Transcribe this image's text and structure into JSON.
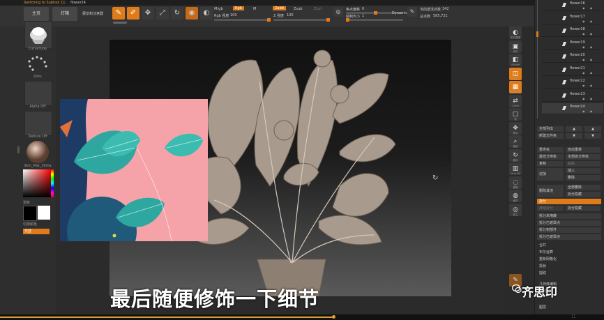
{
  "window": {
    "title": "Switching to Subtool 11:",
    "active_subtool": "flower24"
  },
  "toolbar": {
    "home": "主页",
    "lightbox": "灯箱",
    "lightbox_sub": "展览和注意器",
    "tools": [
      {
        "label": "Edit",
        "icon": "edit-icon",
        "active": true
      },
      {
        "label": "Draw",
        "icon": "draw-icon",
        "active": true
      },
      {
        "label": "Move",
        "icon": "move-icon",
        "active": false
      },
      {
        "label": "Scale",
        "icon": "scale-icon",
        "active": false
      },
      {
        "label": "Rotate",
        "icon": "rotate-icon",
        "active": false
      }
    ],
    "mrgb": "Mrgb",
    "rgb": "Rgb",
    "m": "M",
    "rgb_intensity_label": "Rgb 强度",
    "rgb_intensity_value": "100",
    "zadd": "Zadd",
    "zsub": "Zsub",
    "zcut": "Zcut",
    "z_intensity_label": "Z 强度",
    "z_intensity_value": "100",
    "focal_shift_label": "焦点偏移",
    "focal_shift_value": "0",
    "draw_size_label": "绘制大小",
    "draw_size_value": "1",
    "dynamic": "Dynamic",
    "active_points_label": "当前激活点数",
    "active_points_value": "342",
    "total_points_label": "总点数",
    "total_points_value": "585,721"
  },
  "left_panel": {
    "brush_name": "CurveTube",
    "stroke_name": "Dots",
    "alpha_name": "Alpha Off",
    "texture_name": "Texture Off",
    "material_name": "Skin_Mat_30ma",
    "gradient_label": "渐变",
    "switch_color_label": "切换颜色",
    "alternate_label": "交替"
  },
  "right_toolbar": [
    {
      "label": "实时透视",
      "icon": "bpr-icon"
    },
    {
      "label": "实际",
      "icon": "actual-icon"
    },
    {
      "label": "AAHalf",
      "icon": "aahalf-icon"
    },
    {
      "label": "透视",
      "icon": "persp-icon"
    },
    {
      "label": "地面网格",
      "icon": "floor-icon"
    },
    {
      "label": "L.Sym",
      "icon": "lsym-icon"
    },
    {
      "label": "帧",
      "icon": "frame-icon"
    },
    {
      "label": "移动",
      "icon": "move-view-icon"
    },
    {
      "label": "缩放",
      "icon": "zoom-view-icon"
    },
    {
      "label": "旋转",
      "icon": "rotate-view-icon"
    },
    {
      "label": "Line Fill",
      "icon": "linefill-icon"
    },
    {
      "label": "透明",
      "icon": "transp-icon"
    },
    {
      "label": "幽灵",
      "icon": "ghost-icon"
    },
    {
      "label": "独立",
      "icon": "solo-icon"
    }
  ],
  "subtools": [
    "flower16",
    "flower17",
    "flower18",
    "flower19",
    "flower20",
    "flower21",
    "flower22",
    "flower23",
    "flower24"
  ],
  "subtool_actions": {
    "list_all": "全部列出",
    "new_folder": "新建文件夹",
    "rename": "重命名",
    "auto_reorder": "自动重排",
    "all_low_res": "最低分辨率",
    "all_high_res": "全部高分辨率",
    "copy": "复制",
    "paste": "粘贴",
    "append": "追加",
    "insert": "插入",
    "delete": "删除",
    "delete_other": "删除其他",
    "delete_all": "全部删除",
    "split": "拆分",
    "split_hidden": "拆分隐藏",
    "groups_split": "按组拆分",
    "split_poly": "拆分未掩蔽",
    "split_masked": "拆分已遮罩点",
    "split_to_parts": "拆分到部件",
    "merge": "合并",
    "boolean": "布尔运算",
    "remesh": "重新网格化",
    "project": "投射",
    "extract": "提取",
    "geometry": "几何体编辑",
    "array_mesh": "阵列网格",
    "nanomesh": "图层"
  },
  "subtitle": "最后随便修饰一下细节",
  "watermark": "齐思印"
}
